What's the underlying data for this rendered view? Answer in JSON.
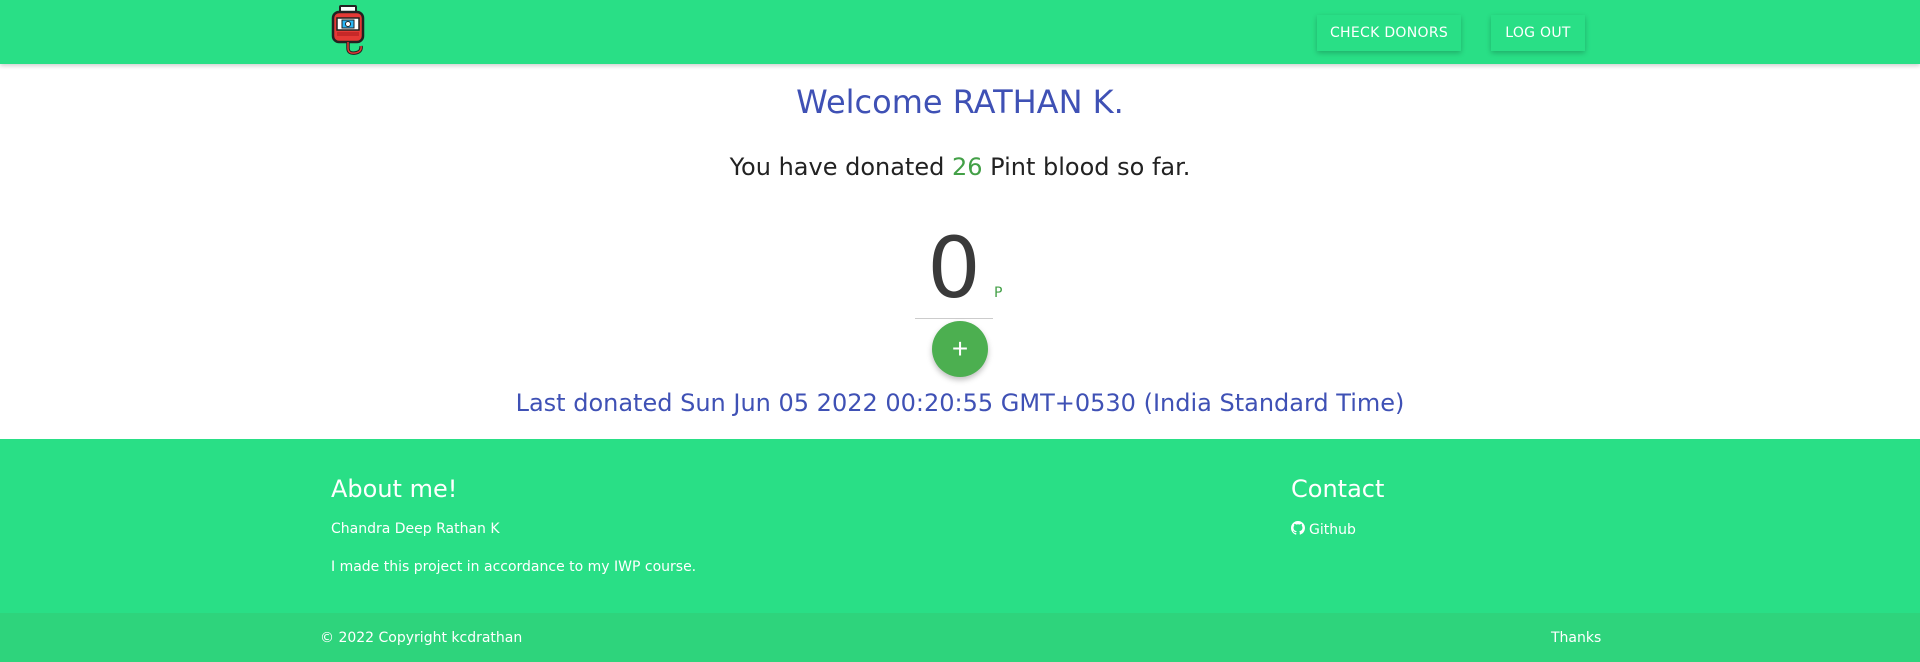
{
  "nav": {
    "logo_icon": "blood-bag-icon",
    "check_donors_label": "CHECK DONORS",
    "logout_label": "LOG OUT"
  },
  "main": {
    "welcome_text": "Welcome RATHAN K.",
    "donated_prefix": "You have donated ",
    "donated_count": "26",
    "donated_suffix": " Pint blood so far.",
    "counter_value": "0",
    "counter_unit": "P",
    "add_icon": "plus-icon",
    "add_label": "+",
    "last_donated": "Last donated Sun Jun 05 2022 00:20:55 GMT+0530 (India Standard Time)"
  },
  "footer": {
    "about_title": "About me!",
    "about_name": "Chandra Deep Rathan K",
    "about_desc": "I made this project in accordance to my IWP course.",
    "contact_title": "Contact",
    "github_icon": "github-icon",
    "github_label": "Github",
    "copyright": "© 2022 Copyright kcdrathan",
    "thanks": "Thanks"
  },
  "colors": {
    "brand_green": "#29df86",
    "heading_blue": "#3f51b5",
    "accent_green": "#43a047"
  }
}
